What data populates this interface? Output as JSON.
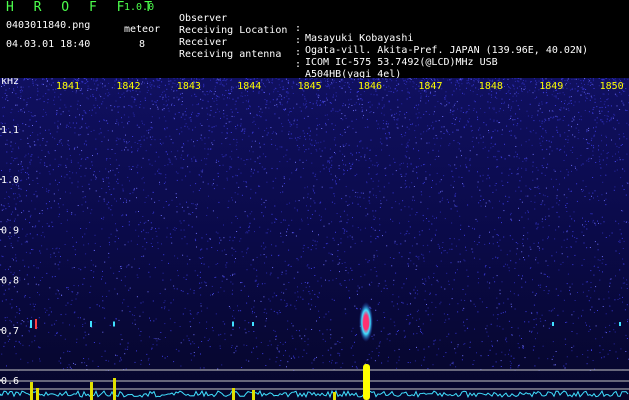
{
  "app": {
    "name": "H R O F F T",
    "version": "1.0.0",
    "filename": "0403011840.png",
    "meteor_label": "meteor",
    "datetime": "04.03.01 18:40",
    "meteor_count": "8"
  },
  "info": [
    {
      "key": "Observer",
      "sep": ":",
      "value": "Masayuki Kobayashi"
    },
    {
      "key": "Receiving Location",
      "sep": ":",
      "value": "Ogata-vill. Akita-Pref. JAPAN (139.96E, 40.02N)"
    },
    {
      "key": "Receiver",
      "sep": ":",
      "value": "ICOM IC-575 53.7492(@LCD)MHz USB"
    },
    {
      "key": "Receiving antenna",
      "sep": ":",
      "value": "A504HB(yagi 4el)"
    }
  ],
  "spectrogram": {
    "unit_label": "kHz",
    "time_labels": [
      "1841",
      "1842",
      "1843",
      "1844",
      "1845",
      "1846",
      "1847",
      "1848",
      "1849",
      "1850"
    ],
    "freq_labels": [
      "1.1",
      "1.0",
      "0.9",
      "0.8",
      "0.7",
      "0.6"
    ],
    "colors": {
      "background": "#0a0a40",
      "noise": "#3a3adc",
      "label_minutes": "#ffff00",
      "label_freq": "#ffffff",
      "meteor_core": "#ff3070",
      "meteor_halo": "#40e0ff",
      "floor_trace": "#40e0ff",
      "level_line": "#c8c8c8"
    }
  }
}
